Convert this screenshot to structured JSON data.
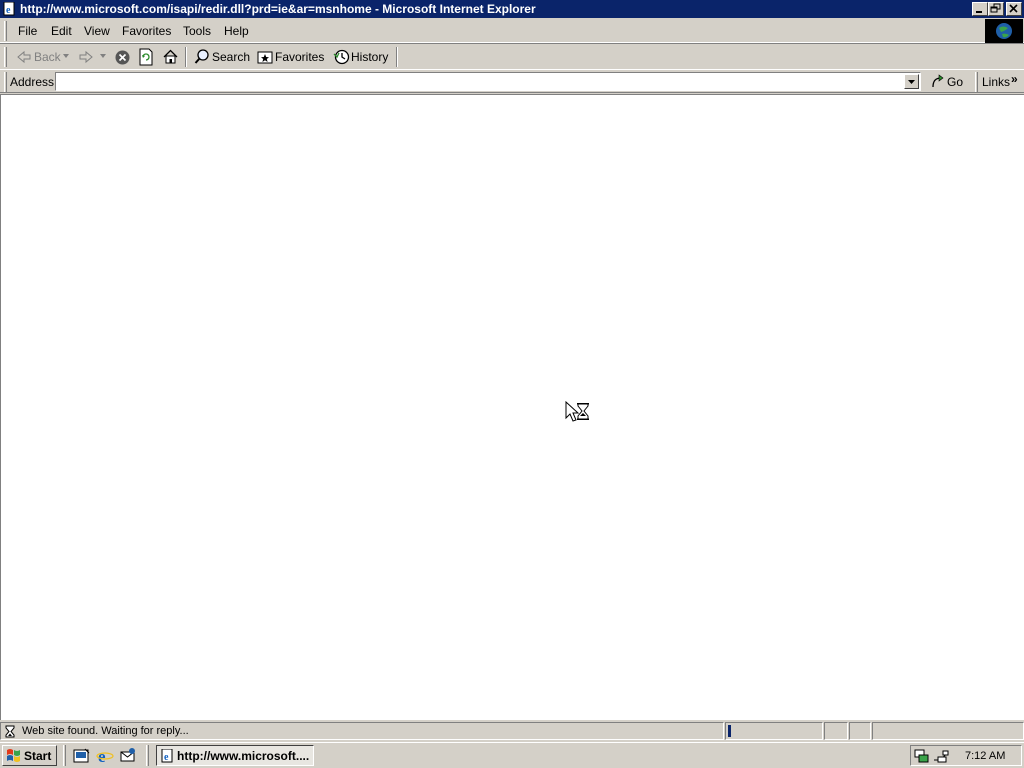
{
  "window": {
    "title": "http://www.microsoft.com/isapi/redir.dll?prd=ie&ar=msnhome - Microsoft Internet Explorer",
    "icon": "ie-page-icon"
  },
  "menu": {
    "items": [
      "File",
      "Edit",
      "View",
      "Favorites",
      "Tools",
      "Help"
    ]
  },
  "toolbar": {
    "back_label": "Back",
    "search_label": "Search",
    "favorites_label": "Favorites",
    "history_label": "History"
  },
  "address": {
    "label": "Address",
    "value": "",
    "go_label": "Go",
    "links_label": "Links",
    "links_chevron": "»"
  },
  "status": {
    "text": "Web site found. Waiting for reply...",
    "progress": 0.02
  },
  "taskbar": {
    "start_label": "Start",
    "task_label": "http://www.microsoft....",
    "clock": "7:12 AM"
  },
  "colors": {
    "titlebar": "#0a246a",
    "face": "#d4d0c8",
    "progress": "#0a246a"
  }
}
